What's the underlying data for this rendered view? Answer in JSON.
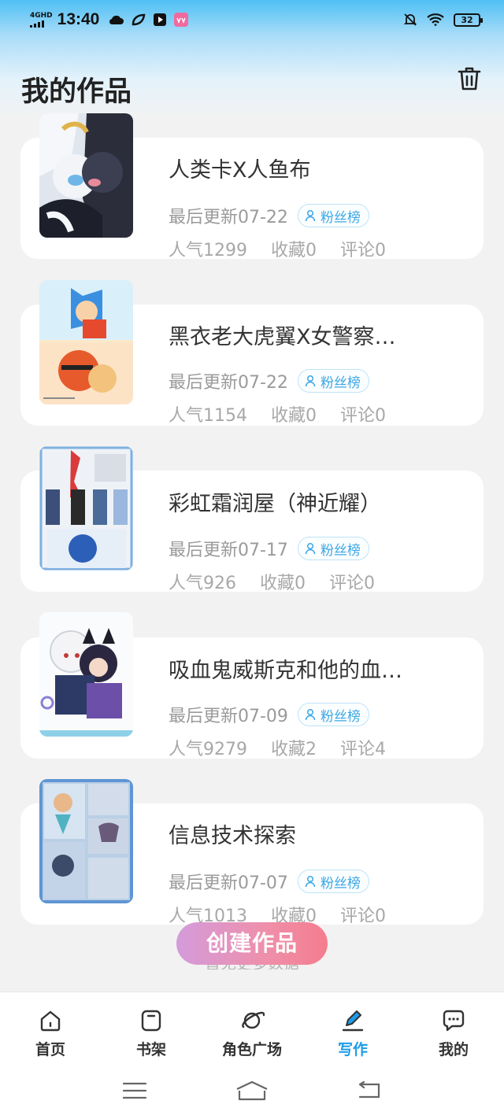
{
  "status_bar": {
    "network": "4GHD",
    "time": "13:40",
    "battery": "32"
  },
  "header": {
    "title": "我的作品"
  },
  "works": [
    {
      "title": "人类卡X人鱼布",
      "updated": "最后更新07-22",
      "badge": "粉丝榜",
      "popularity": "人气1299",
      "favorites": "收藏0",
      "comments": "评论0"
    },
    {
      "title": "黑衣老大虎翼X女警察…",
      "updated": "最后更新07-22",
      "badge": "粉丝榜",
      "popularity": "人气1154",
      "favorites": "收藏0",
      "comments": "评论0"
    },
    {
      "title": "彩虹霜润屋（神近耀）",
      "updated": "最后更新07-17",
      "badge": "粉丝榜",
      "popularity": "人气926",
      "favorites": "收藏0",
      "comments": "评论0"
    },
    {
      "title": "吸血鬼威斯克和他的血…",
      "updated": "最后更新07-09",
      "badge": "粉丝榜",
      "popularity": "人气9279",
      "favorites": "收藏2",
      "comments": "评论4"
    },
    {
      "title": "信息技术探索",
      "updated": "最后更新07-07",
      "badge": "粉丝榜",
      "popularity": "人气1013",
      "favorites": "收藏0",
      "comments": "评论0"
    }
  ],
  "create_button": "创建作品",
  "more_hint": "暂无更多数据",
  "tabs": [
    {
      "label": "首页",
      "icon": "home-icon"
    },
    {
      "label": "书架",
      "icon": "bookshelf-icon"
    },
    {
      "label": "角色广场",
      "icon": "planet-icon"
    },
    {
      "label": "写作",
      "icon": "pen-icon",
      "active": true
    },
    {
      "label": "我的",
      "icon": "chat-bubble-icon"
    }
  ],
  "colors": {
    "accent": "#1e9be8",
    "badge_text": "#3aa7e6",
    "create_gradient_start": "#d49bdb",
    "create_gradient_end": "#f47d8e"
  }
}
